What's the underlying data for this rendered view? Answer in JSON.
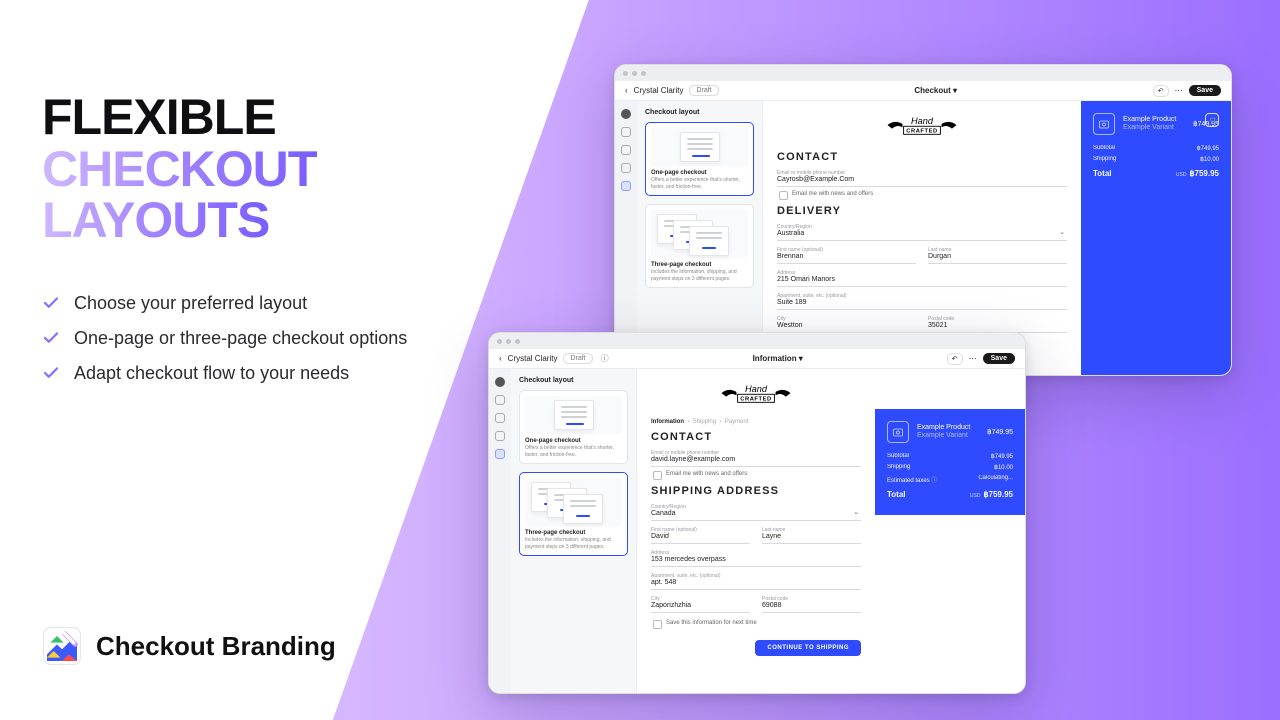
{
  "hero": {
    "title_line1": "Flexible",
    "title_line2": "Checkout",
    "title_line3": "Layouts",
    "bullets": [
      "Choose your preferred layout",
      "One-page or three-page checkout options",
      "Adapt checkout flow to your needs"
    ],
    "brand": "Checkout Branding"
  },
  "panel": {
    "title": "Checkout layout",
    "opt1": {
      "title": "One-page checkout",
      "desc": "Offers a better experience that's shorter, faster, and friction-free."
    },
    "opt2": {
      "title": "Three-page checkout",
      "desc": "Includes the information, shipping, and payment steps on 3 different pages."
    }
  },
  "winA": {
    "shop": "Crystal Clarity",
    "status": "Draft",
    "tab": "Checkout ▾",
    "save": "Save",
    "logo": "Hand Crafted",
    "contact": {
      "heading": "CONTACT",
      "email_label": "Email or mobile phone number",
      "email": "Cayrosb@Example.Com",
      "optin": "Email me with news and offers"
    },
    "delivery": {
      "heading": "DELIVERY",
      "country_label": "Country/Region",
      "country": "Australia",
      "first_label": "First name (optional)",
      "first": "Brennan",
      "last_label": "Last name",
      "last": "Durgan",
      "addr_label": "Address",
      "addr": "215 Omari Manors",
      "apt_label": "Apartment, suite, etc. (optional)",
      "apt": "Suite 189",
      "city_label": "City",
      "city": "Westton",
      "zip_label": "Postal code",
      "zip": "35021"
    },
    "summary": {
      "product": "Example Product",
      "variant": "Example Variant",
      "price": "฿749.95",
      "subtotal_label": "Subtotal",
      "subtotal": "฿749.95",
      "shipping_label": "Shipping",
      "shipping": "฿10.00",
      "total_label": "Total",
      "currency": "USD",
      "total": "฿759.95"
    }
  },
  "winB": {
    "shop": "Crystal Clarity",
    "status": "Draft",
    "tab": "Information ▾",
    "save": "Save",
    "logo": "Hand Crafted",
    "crumbs": {
      "a": "Information",
      "b": "Shipping",
      "c": "Payment"
    },
    "contact": {
      "heading": "CONTACT",
      "email_label": "Email or mobile phone number",
      "email": "david.layne@example.com",
      "optin": "Email me with news and offers"
    },
    "ship": {
      "heading": "SHIPPING ADDRESS",
      "country_label": "Country/Region",
      "country": "Canada",
      "first_label": "First name (optional)",
      "first": "David",
      "last_label": "Last name",
      "last": "Layne",
      "addr_label": "Address",
      "addr": "153 mercedes overpass",
      "apt_label": "Apartment, suite, etc. (optional)",
      "apt": "apt. 548",
      "city_label": "City",
      "city": "Zaporizhzhia",
      "zip_label": "Postal code",
      "zip": "69088",
      "save_info": "Save this information for next time",
      "cta": "CONTINUE TO SHIPPING"
    },
    "summary": {
      "product": "Example Product",
      "variant": "Example Variant",
      "price": "฿749.95",
      "subtotal_label": "Subtotal",
      "subtotal": "฿749.95",
      "shipping_label": "Shipping",
      "shipping": "฿10.00",
      "tax_label": "Estimated taxes",
      "tax": "Calculating...",
      "total_label": "Total",
      "currency": "USD",
      "total": "฿759.95"
    }
  }
}
